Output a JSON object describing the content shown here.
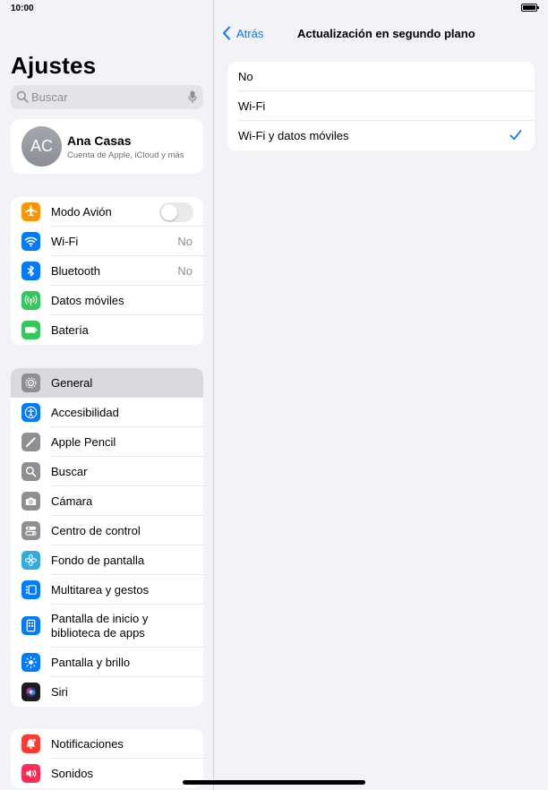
{
  "status_bar": {
    "time": "10:00"
  },
  "sidebar": {
    "title": "Ajustes",
    "search_placeholder": "Buscar",
    "profile": {
      "initials": "AC",
      "name": "Ana Casas",
      "subtitle": "Cuenta de Apple, iCloud y más"
    },
    "group1": [
      {
        "label": "Modo Avión",
        "icon": "airplane-icon",
        "color": "#ff9500",
        "control": "toggle",
        "toggle_on": false
      },
      {
        "label": "Wi-Fi",
        "icon": "wifi-icon",
        "color": "#007aff",
        "value": "No"
      },
      {
        "label": "Bluetooth",
        "icon": "bluetooth-icon",
        "color": "#007aff",
        "value": "No"
      },
      {
        "label": "Datos móviles",
        "icon": "cellular-icon",
        "color": "#34c759"
      },
      {
        "label": "Batería",
        "icon": "battery-icon",
        "color": "#34c759"
      }
    ],
    "group2": [
      {
        "label": "General",
        "icon": "gear-icon",
        "color": "#8e8e93",
        "selected": true
      },
      {
        "label": "Accesibilidad",
        "icon": "accessibility-icon",
        "color": "#007aff"
      },
      {
        "label": "Apple Pencil",
        "icon": "pencil-icon",
        "color": "#8e8e93"
      },
      {
        "label": "Buscar",
        "icon": "search-icon",
        "color": "#8e8e93"
      },
      {
        "label": "Cámara",
        "icon": "camera-icon",
        "color": "#8e8e93"
      },
      {
        "label": "Centro de control",
        "icon": "control-center-icon",
        "color": "#8e8e93"
      },
      {
        "label": "Fondo de pantalla",
        "icon": "wallpaper-icon",
        "color": "#35aadc"
      },
      {
        "label": "Multitarea y gestos",
        "icon": "multitasking-icon",
        "color": "#007aff"
      },
      {
        "label": "Pantalla de inicio y biblioteca de apps",
        "icon": "home-screen-icon",
        "color": "#007aff",
        "tall": true
      },
      {
        "label": "Pantalla y brillo",
        "icon": "brightness-icon",
        "color": "#007aff"
      },
      {
        "label": "Siri",
        "icon": "siri-icon",
        "color": "#1c1c1e"
      }
    ],
    "group3": [
      {
        "label": "Notificaciones",
        "icon": "notifications-icon",
        "color": "#ff3b30"
      },
      {
        "label": "Sonidos",
        "icon": "sounds-icon",
        "color": "#ff2d55"
      }
    ]
  },
  "detail": {
    "back_label": "Atrás",
    "title": "Actualización en segundo plano",
    "options": [
      {
        "label": "No",
        "checked": false
      },
      {
        "label": "Wi-Fi",
        "checked": false
      },
      {
        "label": "Wi-Fi y datos móviles",
        "checked": true
      }
    ],
    "accent_color": "#007aff"
  }
}
